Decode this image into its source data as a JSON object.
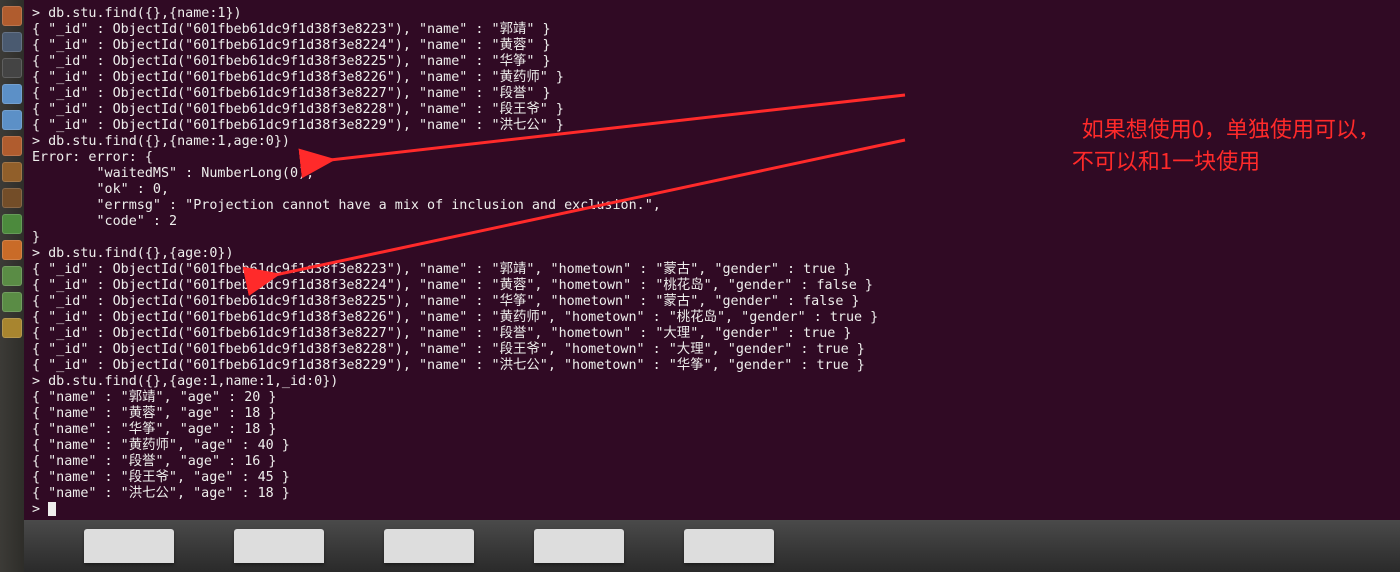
{
  "annotation": {
    "line1": "如果想使用0，单独使用可以，",
    "line2": "不可以和1一块使用"
  },
  "terminal": {
    "prompt": "> ",
    "cmd1": "db.stu.find({},{name:1})",
    "rows1": [
      "{ \"_id\" : ObjectId(\"601fbeb61dc9f1d38f3e8223\"), \"name\" : \"郭靖\" }",
      "{ \"_id\" : ObjectId(\"601fbeb61dc9f1d38f3e8224\"), \"name\" : \"黄蓉\" }",
      "{ \"_id\" : ObjectId(\"601fbeb61dc9f1d38f3e8225\"), \"name\" : \"华筝\" }",
      "{ \"_id\" : ObjectId(\"601fbeb61dc9f1d38f3e8226\"), \"name\" : \"黄药师\" }",
      "{ \"_id\" : ObjectId(\"601fbeb61dc9f1d38f3e8227\"), \"name\" : \"段誉\" }",
      "{ \"_id\" : ObjectId(\"601fbeb61dc9f1d38f3e8228\"), \"name\" : \"段王爷\" }",
      "{ \"_id\" : ObjectId(\"601fbeb61dc9f1d38f3e8229\"), \"name\" : \"洪七公\" }"
    ],
    "cmd2": "db.stu.find({},{name:1,age:0})",
    "error": [
      "Error: error: {",
      "        \"waitedMS\" : NumberLong(0),",
      "        \"ok\" : 0,",
      "        \"errmsg\" : \"Projection cannot have a mix of inclusion and exclusion.\",",
      "        \"code\" : 2",
      "}"
    ],
    "cmd3": "db.stu.find({},{age:0})",
    "rows3": [
      "{ \"_id\" : ObjectId(\"601fbeb61dc9f1d38f3e8223\"), \"name\" : \"郭靖\", \"hometown\" : \"蒙古\", \"gender\" : true }",
      "{ \"_id\" : ObjectId(\"601fbeb61dc9f1d38f3e8224\"), \"name\" : \"黄蓉\", \"hometown\" : \"桃花岛\", \"gender\" : false }",
      "{ \"_id\" : ObjectId(\"601fbeb61dc9f1d38f3e8225\"), \"name\" : \"华筝\", \"hometown\" : \"蒙古\", \"gender\" : false }",
      "{ \"_id\" : ObjectId(\"601fbeb61dc9f1d38f3e8226\"), \"name\" : \"黄药师\", \"hometown\" : \"桃花岛\", \"gender\" : true }",
      "{ \"_id\" : ObjectId(\"601fbeb61dc9f1d38f3e8227\"), \"name\" : \"段誉\", \"hometown\" : \"大理\", \"gender\" : true }",
      "{ \"_id\" : ObjectId(\"601fbeb61dc9f1d38f3e8228\"), \"name\" : \"段王爷\", \"hometown\" : \"大理\", \"gender\" : true }",
      "{ \"_id\" : ObjectId(\"601fbeb61dc9f1d38f3e8229\"), \"name\" : \"洪七公\", \"hometown\" : \"华筝\", \"gender\" : true }"
    ],
    "cmd4": "db.stu.find({},{age:1,name:1,_id:0})",
    "rows4": [
      "{ \"name\" : \"郭靖\", \"age\" : 20 }",
      "{ \"name\" : \"黄蓉\", \"age\" : 18 }",
      "{ \"name\" : \"华筝\", \"age\" : 18 }",
      "{ \"name\" : \"黄药师\", \"age\" : 40 }",
      "{ \"name\" : \"段誉\", \"age\" : 16 }",
      "{ \"name\" : \"段王爷\", \"age\" : 45 }",
      "{ \"name\" : \"洪七公\", \"age\" : 18 }"
    ]
  }
}
